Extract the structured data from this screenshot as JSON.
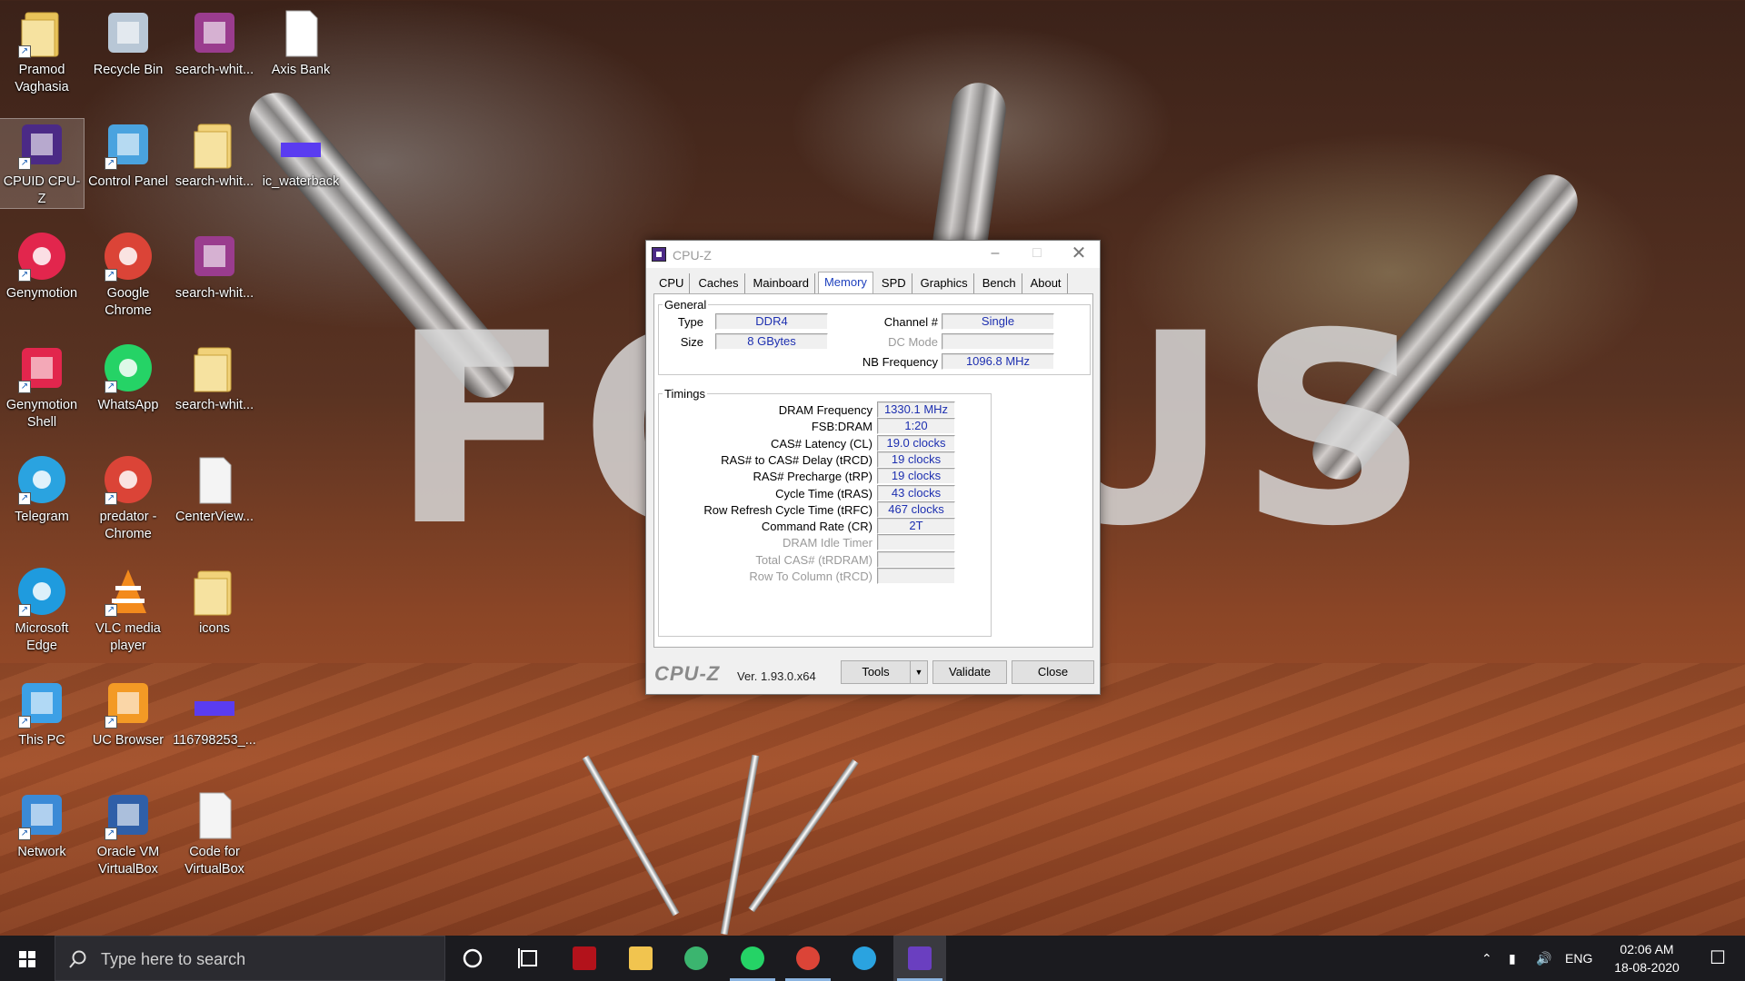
{
  "desktop": {
    "background_text": "FOCUS",
    "icons": [
      {
        "label": "Pramod Vaghasia",
        "icon": "user-folder-icon"
      },
      {
        "label": "Recycle Bin",
        "icon": "recycle-bin-icon"
      },
      {
        "label": "search-whit...",
        "icon": "winrar-icon"
      },
      {
        "label": "Axis Bank",
        "icon": "word-document-icon"
      },
      {
        "label": "CPUID CPU-Z",
        "icon": "cpuz-icon"
      },
      {
        "label": "Control Panel",
        "icon": "control-panel-icon"
      },
      {
        "label": "search-whit...",
        "icon": "folder-icon"
      },
      {
        "label": "ic_waterback",
        "icon": "image-file-icon"
      },
      {
        "label": "Genymotion",
        "icon": "genymotion-icon"
      },
      {
        "label": "Google Chrome",
        "icon": "chrome-icon"
      },
      {
        "label": "search-whit...",
        "icon": "winrar-icon"
      },
      {
        "label": "Genymotion Shell",
        "icon": "genymotion-shell-icon"
      },
      {
        "label": "WhatsApp",
        "icon": "whatsapp-icon"
      },
      {
        "label": "search-whit...",
        "icon": "folder-icon"
      },
      {
        "label": "Telegram",
        "icon": "telegram-icon"
      },
      {
        "label": "predator - Chrome",
        "icon": "chrome-profile-icon"
      },
      {
        "label": "CenterView...",
        "icon": "blank-file-icon"
      },
      {
        "label": "Microsoft Edge",
        "icon": "edge-icon"
      },
      {
        "label": "VLC media player",
        "icon": "vlc-icon"
      },
      {
        "label": "icons",
        "icon": "folder-icon"
      },
      {
        "label": "This PC",
        "icon": "this-pc-icon"
      },
      {
        "label": "UC Browser",
        "icon": "uc-browser-icon"
      },
      {
        "label": "116798253_...",
        "icon": "image-file-icon"
      },
      {
        "label": "Network",
        "icon": "network-icon"
      },
      {
        "label": "Oracle VM VirtualBox",
        "icon": "virtualbox-icon"
      },
      {
        "label": "Code for VirtualBox",
        "icon": "blank-file-icon"
      }
    ]
  },
  "cpuz": {
    "title": "CPU-Z",
    "tabs": [
      "CPU",
      "Caches",
      "Mainboard",
      "Memory",
      "SPD",
      "Graphics",
      "Bench",
      "About"
    ],
    "active_tab": "Memory",
    "general": {
      "legend": "General",
      "type_label": "Type",
      "type_value": "DDR4",
      "size_label": "Size",
      "size_value": "8 GBytes",
      "channel_label": "Channel #",
      "channel_value": "Single",
      "dcmode_label": "DC Mode",
      "dcmode_value": "",
      "nbfreq_label": "NB Frequency",
      "nbfreq_value": "1096.8 MHz"
    },
    "timings": {
      "legend": "Timings",
      "rows": [
        {
          "label": "DRAM Frequency",
          "value": "1330.1 MHz",
          "dim": false
        },
        {
          "label": "FSB:DRAM",
          "value": "1:20",
          "dim": false
        },
        {
          "label": "CAS# Latency (CL)",
          "value": "19.0 clocks",
          "dim": false
        },
        {
          "label": "RAS# to CAS# Delay (tRCD)",
          "value": "19 clocks",
          "dim": false
        },
        {
          "label": "RAS# Precharge (tRP)",
          "value": "19 clocks",
          "dim": false
        },
        {
          "label": "Cycle Time (tRAS)",
          "value": "43 clocks",
          "dim": false
        },
        {
          "label": "Row Refresh Cycle Time (tRFC)",
          "value": "467 clocks",
          "dim": false
        },
        {
          "label": "Command Rate (CR)",
          "value": "2T",
          "dim": false
        },
        {
          "label": "DRAM Idle Timer",
          "value": "",
          "dim": true
        },
        {
          "label": "Total CAS# (tRDRAM)",
          "value": "",
          "dim": true
        },
        {
          "label": "Row To Column (tRCD)",
          "value": "",
          "dim": true
        }
      ]
    },
    "footer": {
      "brand": "CPU-Z",
      "version": "Ver. 1.93.0.x64",
      "tools_label": "Tools",
      "validate_label": "Validate",
      "close_label": "Close"
    }
  },
  "taskbar": {
    "search_placeholder": "Type here to search",
    "apps": [
      "cortana-icon",
      "task-view-icon",
      "predator-icon",
      "file-explorer-icon",
      "maps-icon",
      "whatsapp-icon",
      "chrome-icon",
      "telegram-icon",
      "cpuz-icon"
    ],
    "language": "ENG",
    "time": "02:06 AM",
    "date": "18-08-2020"
  }
}
